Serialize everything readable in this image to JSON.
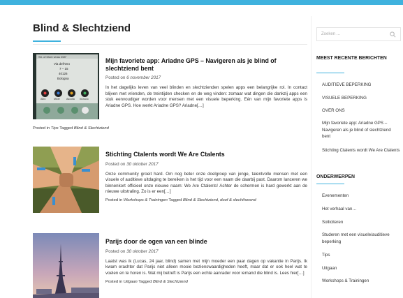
{
  "page": {
    "title": "Blind & Slechtziend"
  },
  "posts": [
    {
      "title": "Mijn favoriete app: Ariadne GPS – Navigeren als je blind of slechtziend bent",
      "posted_label": "Posted on",
      "date": "6 november 2017",
      "excerpt": "In het dagelijks leven van veel blinden en slechtzienden spelen apps een belangrijke rol. In contact blijven met vrienden, de treintijden checken en de weg vinden: zomaar wat dingen die dankzij apps een stuk eenvoudiger worden voor mensen met een visuele beperking. Eén van mijn favoriete apps is Ariadne GPS. Hoe werkt Ariadne GPS? Ariadne[…]",
      "posted_in_label": "Posted in",
      "category": "Tips",
      "tagged_label": "Tagged",
      "tags": "Blind & Slechtziend",
      "thumb_text": {
        "status": "Str. of Mont Unas   258°",
        "lines": [
          "Via dell'Oro",
          "7 – 15",
          "40126",
          "Bologna"
        ],
        "buttons": [
          "Altro",
          "Mixer",
          "Ascolta",
          "Incrocio"
        ]
      }
    },
    {
      "title": "Stichting Ctalents wordt We Are Ctalents",
      "posted_label": "Posted on",
      "date": "30 oktober 2017",
      "excerpt": "Onze community groeit hard. Om nog beter onze doelgroep van jonge, talentvolle mensen met een visuele of auditieve uitdaging te bereiken is het tijd voor een naam die daarbij past. Daarom lanceren we binnenkort officieel onze nieuwe naam: We Are Ctalents! Achter de schermen is hard gewerkt aan de nieuwe uitstraling. Zo is er een[…]",
      "posted_in_label": "Posted in",
      "category": "Workshops & Trainingen",
      "tagged_label": "Tagged",
      "tags": "Blind & Slechtziend, doof & slechthorend"
    },
    {
      "title": "Parijs door de ogen van een blinde",
      "posted_label": "Posted on",
      "date": "30 oktober 2017",
      "excerpt": "Laatst was ik (Lucas, 24 jaar, blind) samen met mijn moeder een paar dagen op vakantie in Parijs. Ik kwam erachter dat Parijs niet alleen mooie bezienswaardigheden heeft, maar dat er ook heel wat te voelen en te horen is. Wat mij betreft is Parijs een echte aanrader voor iemand die blind is. Lees hier[…]",
      "posted_in_label": "Posted in",
      "category": "Uitgaan",
      "tagged_label": "Tagged",
      "tags": "Blind & Slechtziend"
    }
  ],
  "sidebar": {
    "search_placeholder": "Zoeken …",
    "search_icon": "search-icon",
    "recent_title": "MEEST RECENTE BERICHTEN",
    "recent": [
      "AUDITIEVE BEPERKING",
      "VISUELE BEPERKING",
      "OVER ONS",
      "Mijn favoriete app: Ariadne GPS – Navigeren als je blind of slechtziend bent",
      "Stichting Ctalents wordt We Are Ctalents"
    ],
    "topics_title": "ONDERWERPEN",
    "topics": [
      "Evenementen",
      "Het verhaal van…",
      "Solliciteren",
      "Studeren met een visuele/auditieve beperking",
      "Tips",
      "Uitgaan",
      "Workshops & Trainingen"
    ]
  },
  "colors": {
    "accent": "#3fb2de",
    "background": "#ffffff"
  }
}
